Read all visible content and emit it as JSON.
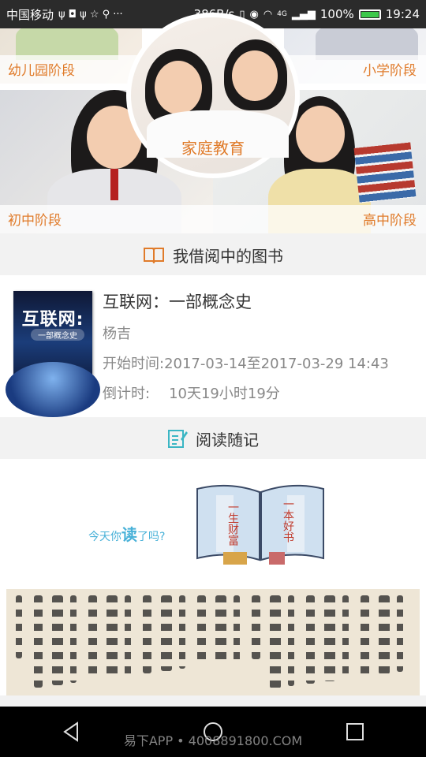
{
  "status_bar": {
    "carrier": "中国移动",
    "icons": "ψ ◘ ψ ☆ ⚲ ···",
    "net_speed": "386B/s",
    "signal_label": "4G",
    "battery": "100%",
    "time": "19:24",
    "battery_level": 1.0
  },
  "banner": {
    "kindergarten": "幼儿园阶段",
    "primary": "小学阶段",
    "family": "家庭教育",
    "junior": "初中阶段",
    "senior": "高中阶段"
  },
  "borrowed_section": {
    "title": "我借阅中的图书",
    "icon": "open-book-icon"
  },
  "book": {
    "cover_title": "互联网:",
    "cover_subtitle": "一部概念史",
    "title": "互联网：一部概念史",
    "author": "杨吉",
    "start_label": "开始时间:",
    "start_range": "2017-03-14至2017-03-29 14:43",
    "countdown_label": "倒计时:",
    "countdown_value": "10天19小时19分"
  },
  "notes_section": {
    "title": "阅读随记",
    "icon": "notes-edit-icon"
  },
  "notes_ad": {
    "prefix": "今天你",
    "emphasis": "读",
    "suffix": "了吗?",
    "book_left": "一生财富",
    "book_right": "一本好书"
  },
  "watermark": "易下APP • 4008891800.COM",
  "colors": {
    "accent": "#e07b2a",
    "notes_icon": "#3bb6c4",
    "ad_text": "#48b1d8"
  }
}
